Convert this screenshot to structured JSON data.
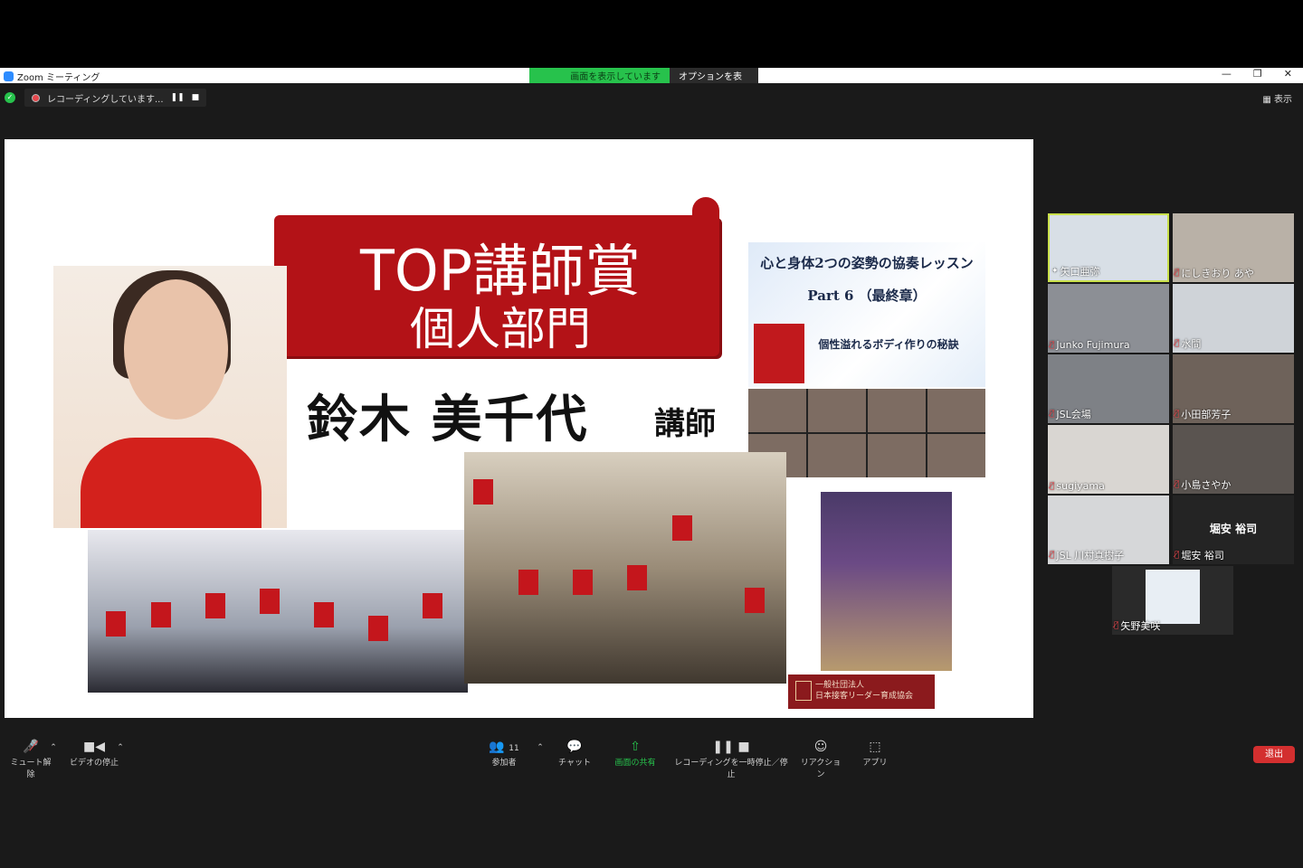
{
  "window": {
    "app_title": "Zoom ミーティング",
    "share_status": "画面を表示しています",
    "options_label": "オプションを表示",
    "view_label": "表示",
    "recording_text": "レコーディングしています..."
  },
  "slide": {
    "banner_title": "TOP講師賞",
    "banner_sub": "個人部門",
    "person_name": "鈴木 美千代",
    "honor": "講師",
    "book_title": "心と身体2つの姿勢の協奏レッスン",
    "book_part": "Part 6 （最終章）",
    "book_tagline": "個性溢れるボディ作りの秘訣",
    "assoc_line1": "一般社団法人",
    "assoc_line2": "日本接客リーダー育成協会"
  },
  "participants": [
    {
      "name": "矢口亜弥",
      "muted": false,
      "active": true
    },
    {
      "name": "にしきおり あや",
      "muted": true
    },
    {
      "name": "Junko Fujimura",
      "muted": true
    },
    {
      "name": "水間",
      "muted": true
    },
    {
      "name": "JSL会場",
      "muted": true
    },
    {
      "name": "小田部芳子",
      "muted": true
    },
    {
      "name": "sugiyama",
      "muted": true
    },
    {
      "name": "小島さやか",
      "muted": true
    },
    {
      "name": "JSL 川村真樹子",
      "muted": true
    },
    {
      "name": "堀安 裕司",
      "muted": true,
      "display_name": "堀安 裕司"
    },
    {
      "name": "矢野美咲",
      "muted": true
    }
  ],
  "toolbar": {
    "mute": "ミュート解除",
    "video": "ビデオの停止",
    "participants": "参加者",
    "participant_count": "11",
    "chat": "チャット",
    "share": "画面の共有",
    "record": "レコーディングを一時停止／停止",
    "reactions": "リアクション",
    "apps": "アプリ",
    "exit": "退出"
  }
}
